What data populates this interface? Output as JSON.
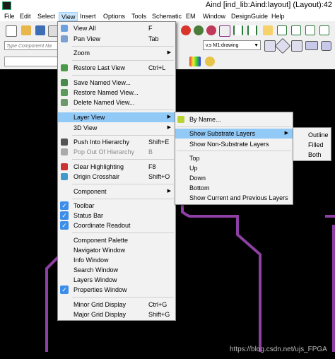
{
  "window": {
    "title": "Aind [ind_lib:Aind:layout] (Layout):42"
  },
  "menubar": [
    "File",
    "Edit",
    "Select",
    "View",
    "Insert",
    "Options",
    "Tools",
    "Schematic",
    "EM",
    "Window",
    "DesignGuide",
    "Help"
  ],
  "toolbar": {
    "component_placeholder": "Type Component Na",
    "layer_value": "v,s M1:drawing"
  },
  "view_menu": [
    {
      "label": "View All",
      "shortcut": "F"
    },
    {
      "label": "Pan View",
      "shortcut": "Tab"
    },
    {
      "label": "Zoom",
      "shortcut": ""
    },
    {
      "label": "Restore Last View",
      "shortcut": "Ctrl+L"
    },
    {
      "label": "Save Named View...",
      "shortcut": ""
    },
    {
      "label": "Restore Named View...",
      "shortcut": ""
    },
    {
      "label": "Delete Named View...",
      "shortcut": ""
    },
    {
      "label": "Layer View",
      "shortcut": ""
    },
    {
      "label": "3D View",
      "shortcut": ""
    },
    {
      "label": "Push Into Hierarchy",
      "shortcut": "Shift+E"
    },
    {
      "label": "Pop Out Of Hierarchy",
      "shortcut": "B"
    },
    {
      "label": "Clear Highlighting",
      "shortcut": "F8"
    },
    {
      "label": "Origin Crosshair",
      "shortcut": "Shift+O"
    },
    {
      "label": "Component",
      "shortcut": ""
    },
    {
      "label": "Toolbar",
      "shortcut": ""
    },
    {
      "label": "Status Bar",
      "shortcut": ""
    },
    {
      "label": "Coordinate Readout",
      "shortcut": ""
    },
    {
      "label": "Component Palette",
      "shortcut": ""
    },
    {
      "label": "Navigator Window",
      "shortcut": ""
    },
    {
      "label": "Info Window",
      "shortcut": ""
    },
    {
      "label": "Search Window",
      "shortcut": ""
    },
    {
      "label": "Layers Window",
      "shortcut": ""
    },
    {
      "label": "Properties Window",
      "shortcut": ""
    },
    {
      "label": "Minor Grid Display",
      "shortcut": "Ctrl+G"
    },
    {
      "label": "Major Grid Display",
      "shortcut": "Shift+G"
    }
  ],
  "layer_view_menu": [
    "By Name...",
    "Show Substrate Layers",
    "Show Non-Substrate Layers",
    "Top",
    "Up",
    "Down",
    "Bottom",
    "Show Current and Previous Layers"
  ],
  "substrate_menu": [
    "Outline",
    "Filled",
    "Both"
  ],
  "watermark": "https://blog.csdn.net/ujs_FPGA",
  "colors": {
    "menu_highlight": "#91c9f7",
    "canvas": "#000000",
    "trace": "#8e3fa3",
    "check": "#3d8ee8"
  }
}
